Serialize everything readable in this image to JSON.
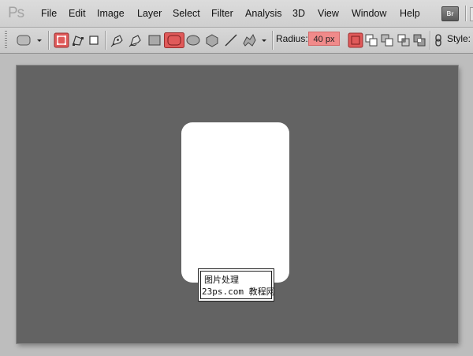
{
  "app": {
    "logo": "Ps"
  },
  "menu": {
    "items": [
      {
        "id": "file",
        "label": "File"
      },
      {
        "id": "edit",
        "label": "Edit"
      },
      {
        "id": "image",
        "label": "Image"
      },
      {
        "id": "layer",
        "label": "Layer"
      },
      {
        "id": "select",
        "label": "Select"
      },
      {
        "id": "filter",
        "label": "Filter"
      },
      {
        "id": "analysis",
        "label": "Analysis"
      },
      {
        "id": "3d",
        "label": "3D"
      },
      {
        "id": "view",
        "label": "View"
      },
      {
        "id": "window",
        "label": "Window"
      },
      {
        "id": "help",
        "label": "Help"
      }
    ],
    "bridge_label": "Br"
  },
  "options": {
    "radius_label": "Radius:",
    "radius_value": "40 px",
    "style_label": "Style:",
    "accent": "#e05a5a",
    "highlight": "#f08a8a"
  },
  "watermark": {
    "line1": "图片处理",
    "line2": "23ps.com 教程网"
  },
  "colors": {
    "canvas": "#636363",
    "shape": "#ffffff"
  }
}
